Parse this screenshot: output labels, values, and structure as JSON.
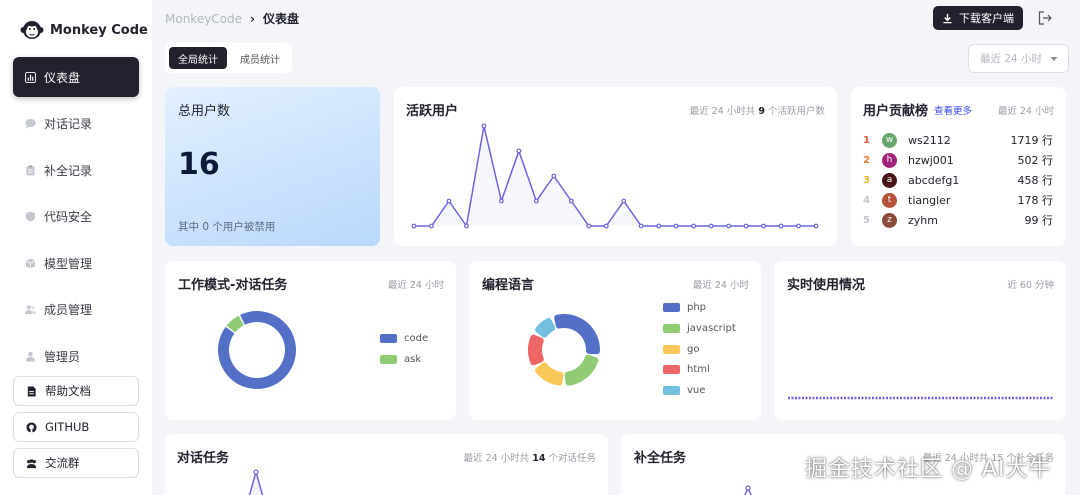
{
  "app": {
    "name": "Monkey Code"
  },
  "sidebar": {
    "items": [
      {
        "label": "仪表盘",
        "icon": "dashboard-icon",
        "active": true
      },
      {
        "label": "对话记录",
        "icon": "chat-icon"
      },
      {
        "label": "补全记录",
        "icon": "clipboard-icon"
      },
      {
        "label": "代码安全",
        "icon": "shield-icon"
      },
      {
        "label": "模型管理",
        "icon": "cube-icon"
      },
      {
        "label": "成员管理",
        "icon": "users-icon"
      },
      {
        "label": "管理员",
        "icon": "user-icon"
      }
    ],
    "links": [
      {
        "label": "帮助文档",
        "icon": "doc-icon"
      },
      {
        "label": "GITHUB",
        "icon": "github-icon"
      },
      {
        "label": "交流群",
        "icon": "group-icon"
      }
    ]
  },
  "header": {
    "breadcrumb": {
      "root": "MonkeyCode",
      "sep": "›",
      "current": "仪表盘"
    },
    "download_label": "下载客户端",
    "logout_icon": "logout-icon"
  },
  "tabs": [
    {
      "label": "全局统计",
      "active": true
    },
    {
      "label": "成员统计"
    }
  ],
  "range_select": {
    "value": "最近 24 小时"
  },
  "total_users": {
    "title": "总用户数",
    "value": "16",
    "note": "其中 0 个用户被禁用"
  },
  "active_users": {
    "title": "活跃用户",
    "subtitle_pre": "最近 24 小时共",
    "subtitle_num": "9",
    "subtitle_post": "个活跃用户数"
  },
  "contributors": {
    "title": "用户贡献榜",
    "more": "查看更多",
    "subtitle": "最近 24 小时",
    "rows": [
      {
        "rank": "1",
        "initial": "w",
        "name": "ws2112",
        "value": "1719 行",
        "color": "#6aa56f",
        "rank_color": "#e5533a"
      },
      {
        "rank": "2",
        "initial": "h",
        "name": "hzwj001",
        "value": "502 行",
        "color": "#a0237a",
        "rank_color": "#ef7c2c"
      },
      {
        "rank": "3",
        "initial": "a",
        "name": "abcdefg1",
        "value": "458 行",
        "color": "#4a1518",
        "rank_color": "#f3b42b"
      },
      {
        "rank": "4",
        "initial": "t",
        "name": "tiangler",
        "value": "178 行",
        "color": "#b5523a",
        "rank_color": "#c5c7cf"
      },
      {
        "rank": "5",
        "initial": "z",
        "name": "zyhm",
        "value": "99 行",
        "color": "#8a4a3c",
        "rank_color": "#c5c7cf"
      }
    ]
  },
  "work_mode": {
    "title": "工作模式-对话任务",
    "subtitle": "最近 24 小时"
  },
  "languages": {
    "title": "编程语言",
    "subtitle": "最近 24 小时"
  },
  "realtime": {
    "title": "实时使用情况",
    "subtitle": "近 60 分钟"
  },
  "chat_tasks": {
    "title": "对话任务",
    "subtitle_pre": "最近 24 小时共",
    "subtitle_num": "14",
    "subtitle_post": "个对话任务"
  },
  "completion_tasks": {
    "title": "补全任务",
    "subtitle": "最近 24 小时共 15 个补全任务"
  },
  "watermark": "掘金技术社区 @ AI大牛",
  "chart_data": [
    {
      "type": "line",
      "title": "活跃用户",
      "values": [
        0,
        0,
        2,
        0,
        8,
        2,
        6,
        2,
        4,
        2,
        0,
        0,
        2,
        0,
        0,
        0,
        0,
        0,
        0,
        0,
        0,
        0,
        0,
        0
      ],
      "color": "#6c63e0"
    },
    {
      "type": "pie",
      "title": "工作模式-对话任务",
      "categories": [
        "code",
        "ask"
      ],
      "values": [
        13,
        1
      ],
      "colors": [
        "#5470c6",
        "#91cc75"
      ]
    },
    {
      "type": "pie",
      "title": "编程语言",
      "categories": [
        "php",
        "javascript",
        "go",
        "html",
        "vue"
      ],
      "values": [
        30,
        20,
        15,
        15,
        10
      ],
      "colors": [
        "#5470c6",
        "#91cc75",
        "#fac858",
        "#ee6666",
        "#73c0de"
      ]
    }
  ]
}
